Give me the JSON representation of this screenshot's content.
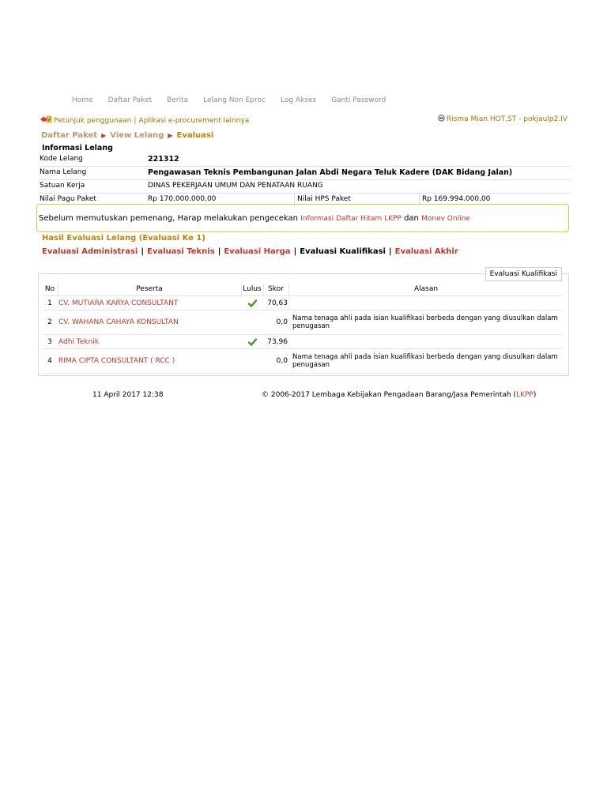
{
  "nav": [
    "Home",
    "Daftar Paket",
    "Berita",
    "Lelang Non Eproc",
    "Log Akses",
    "Ganti Password"
  ],
  "helper": {
    "petunjuk": "Petunjuk penggunaan",
    "sep": "|",
    "aplikasi": "Aplikasi e-procurement lainnya",
    "user": "Risma Mian HOT,ST - pokjaulp2.IV"
  },
  "breadcrumb": [
    "Daftar Paket",
    "View Lelang",
    "Evaluasi"
  ],
  "info": {
    "title": "Informasi Lelang",
    "kode_label": "Kode Lelang",
    "kode_value": "221312",
    "nama_label": "Nama Lelang",
    "nama_value": "Pengawasan Teknis Pembangunan Jalan Abdi Negara Teluk Kadere (DAK Bidang Jalan)",
    "satuan_label": "Satuan Kerja",
    "satuan_value": "DINAS PEKERJAAN UMUM DAN PENATAAN RUANG",
    "pagu_label": "Nilai Pagu Paket",
    "pagu_value": "Rp 170.000.000,00",
    "hps_label": "Nilai HPS Paket",
    "hps_value": "Rp 169.994.000,00"
  },
  "warning": {
    "text": "Sebelum memutuskan pemenang, Harap melakukan pengecekan",
    "link1": "Informasi Daftar Hitam LKPP",
    "dan": "dan",
    "link2": "Monev Online"
  },
  "hasil_title": "Hasil Evaluasi Lelang (Evaluasi Ke 1)",
  "tabs": {
    "administrasi": "Evaluasi Administrasi",
    "teknis": "Evaluasi Teknis",
    "harga": "Evaluasi Harga",
    "kualifikasi": "Evaluasi Kualifikasi",
    "akhir": "Evaluasi Akhir",
    "bar": "|"
  },
  "panel": {
    "legend": "Evaluasi Kualifikasi",
    "headers": {
      "no": "No",
      "peserta": "Peserta",
      "lulus": "Lulus",
      "skor": "Skor",
      "alasan": "Alasan"
    },
    "rows": [
      {
        "no": "1",
        "peserta": "CV. MUTIARA KARYA CONSULTANT",
        "lulus": true,
        "skor": "70,63",
        "alasan": ""
      },
      {
        "no": "2",
        "peserta": "CV. WAHANA CAHAYA KONSULTAN",
        "lulus": false,
        "skor": "0,0",
        "alasan": "Nama tenaga ahli pada isian kualifikasi berbeda dengan yang diusulkan dalam penugasan"
      },
      {
        "no": "3",
        "peserta": "Adhi Teknik",
        "lulus": true,
        "skor": "73,96",
        "alasan": ""
      },
      {
        "no": "4",
        "peserta": "RIMA CIPTA CONSULTANT ( RCC )",
        "lulus": false,
        "skor": "0,0",
        "alasan": "Nama tenaga ahli pada isian kualifikasi berbeda dengan yang diusulkan dalam penugasan"
      }
    ]
  },
  "footer": {
    "date": "11 April 2017 12:38",
    "copyright": "© 2006-2017 Lembaga Kebijakan Pengadaan Barang/Jasa Pemerintah (",
    "lkpp": "LKPP",
    "close": ")"
  },
  "colors": {
    "link": "#c0392b",
    "gold": "#b8860b",
    "check": "#3a9a2a",
    "warn_border": "#f0c040"
  }
}
